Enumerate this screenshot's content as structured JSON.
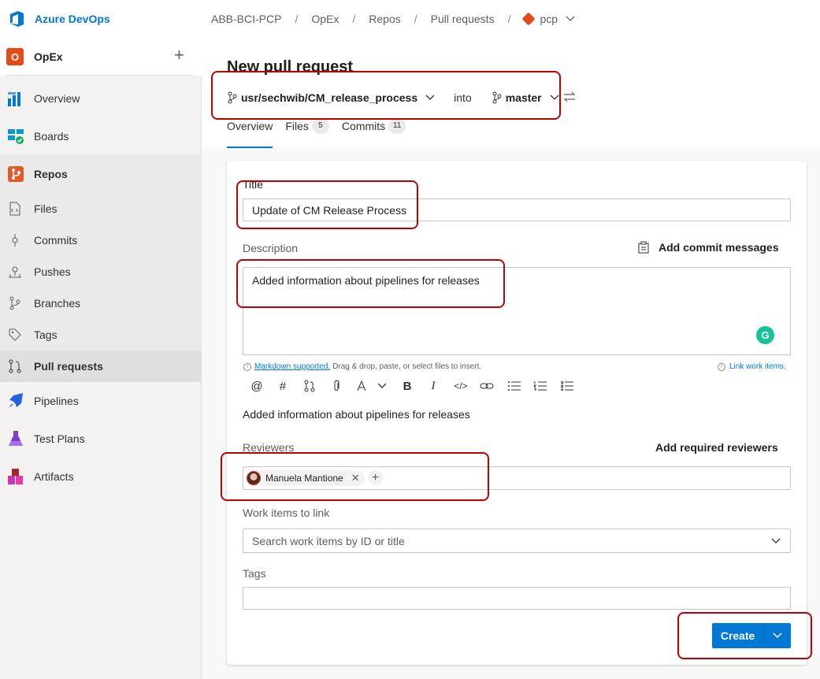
{
  "app": {
    "brand": "Azure DevOps",
    "project": "OpEx",
    "project_initial": "O"
  },
  "breadcrumb": {
    "org": "ABB-BCI-PCP",
    "project": "OpEx",
    "section": "Repos",
    "page": "Pull requests",
    "repo": "pcp"
  },
  "sidebar": {
    "overview": "Overview",
    "boards": "Boards",
    "repos": "Repos",
    "files": "Files",
    "commits": "Commits",
    "pushes": "Pushes",
    "branches": "Branches",
    "tags": "Tags",
    "pull_requests": "Pull requests",
    "pipelines": "Pipelines",
    "test_plans": "Test Plans",
    "artifacts": "Artifacts"
  },
  "main": {
    "title": "New pull request",
    "source_branch": "usr/sechwib/CM_release_process",
    "into": "into",
    "target_branch": "master",
    "tabs": {
      "overview": "Overview",
      "files": "Files",
      "files_count": "5",
      "commits": "Commits",
      "commits_count": "11"
    }
  },
  "form": {
    "title_label": "Title",
    "title_value": "Update of CM Release Process",
    "description_label": "Description",
    "add_commit_messages": "Add commit messages",
    "description_value": "Added information about pipelines for releases",
    "markdown_link": "Markdown supported.",
    "markdown_hint": "Drag & drop, paste, or select files to insert.",
    "link_work_items": "Link work items.",
    "preview_text": "Added information about pipelines for releases",
    "reviewers_label": "Reviewers",
    "add_required_reviewers": "Add required reviewers",
    "reviewer_name": "Manuela Mantione",
    "work_items_label": "Work items to link",
    "work_items_placeholder": "Search work items by ID or title",
    "tags_label": "Tags",
    "create_label": "Create"
  },
  "toolbar_icons": [
    "mention-icon",
    "hash-icon",
    "pull-request-icon",
    "attach-icon",
    "highlight-icon",
    "bold-icon",
    "italic-icon",
    "code-icon",
    "link-icon",
    "bullet-list-icon",
    "numbered-list-icon",
    "checklist-icon"
  ],
  "colors": {
    "accent": "#0078d4",
    "annotation": "#c00000",
    "project_tile": "#e64a19"
  }
}
